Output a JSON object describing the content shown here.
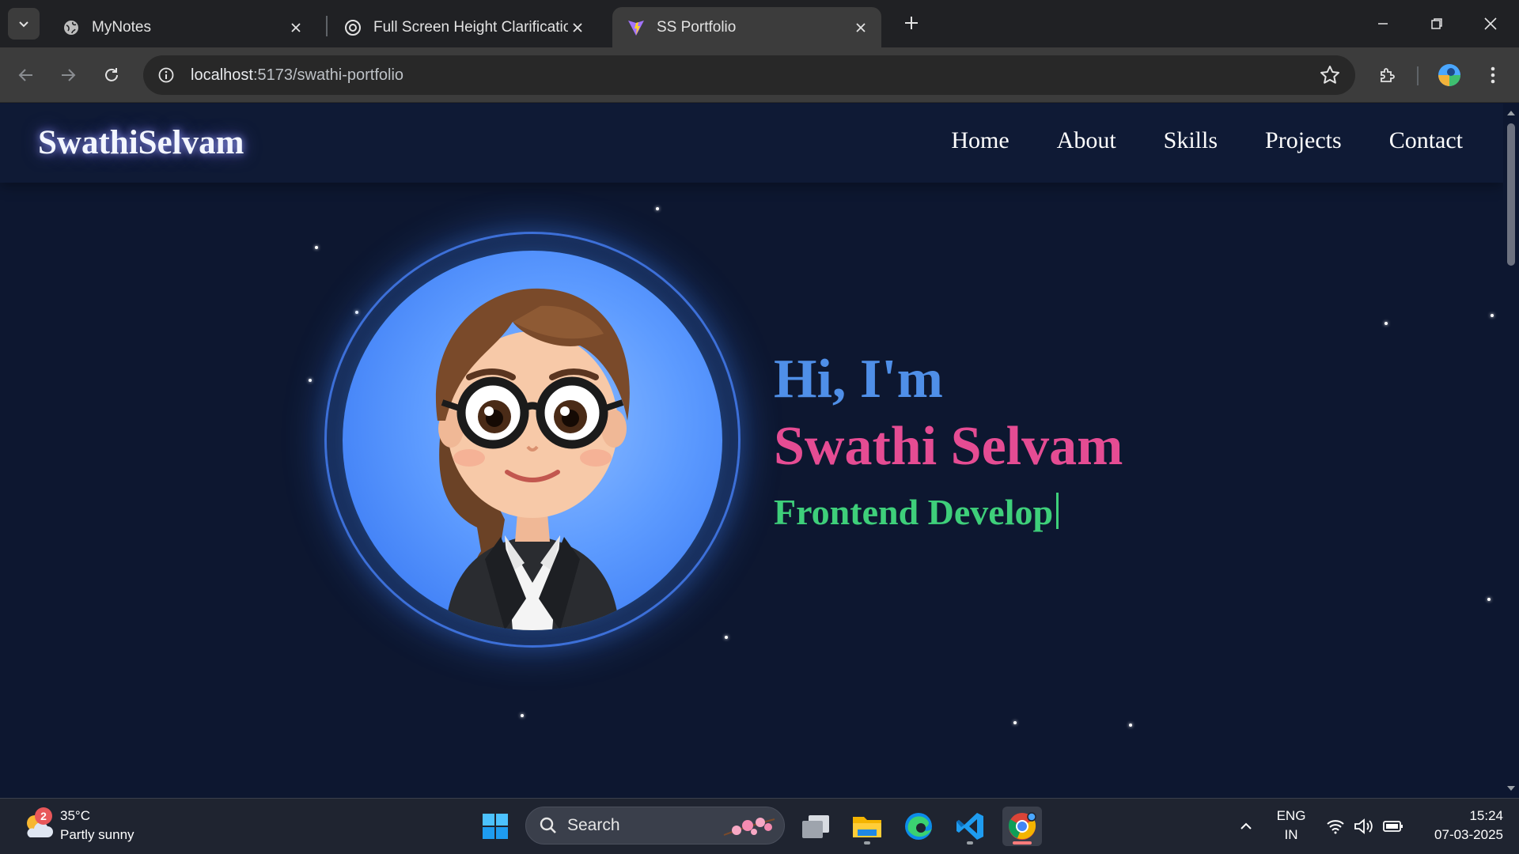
{
  "browser": {
    "tabs": [
      {
        "title": "MyNotes",
        "favicon": "globe-icon",
        "active": false
      },
      {
        "title": "Full Screen Height Clarification",
        "favicon": "chatgpt-icon",
        "active": false
      },
      {
        "title": "SS Portfolio",
        "favicon": "vite-icon",
        "active": true
      }
    ],
    "url_host": "localhost",
    "url_path": ":5173/swathi-portfolio"
  },
  "site": {
    "logo": "SwathiSelvam",
    "nav": [
      "Home",
      "About",
      "Skills",
      "Projects",
      "Contact"
    ],
    "hero": {
      "greeting": "Hi, I'm",
      "name": "Swathi Selvam",
      "role_typed": "Frontend Develop"
    },
    "colors": {
      "background": "#0d1730",
      "greeting": "#4f8fe8",
      "name": "#e54c93",
      "role": "#3ecf7a",
      "avatar_ring": "#3d6ed6"
    }
  },
  "taskbar": {
    "weather": {
      "temp": "35°C",
      "condition": "Partly sunny",
      "badge": "2"
    },
    "search_label": "Search",
    "pinned_apps": [
      "windows-start-icon",
      "search-icon",
      "task-view-icon",
      "file-explorer-icon",
      "edge-icon",
      "vscode-icon",
      "chrome-icon"
    ],
    "tray": {
      "lang": "ENG",
      "region": "IN",
      "time": "15:24",
      "date": "07-03-2025"
    }
  }
}
